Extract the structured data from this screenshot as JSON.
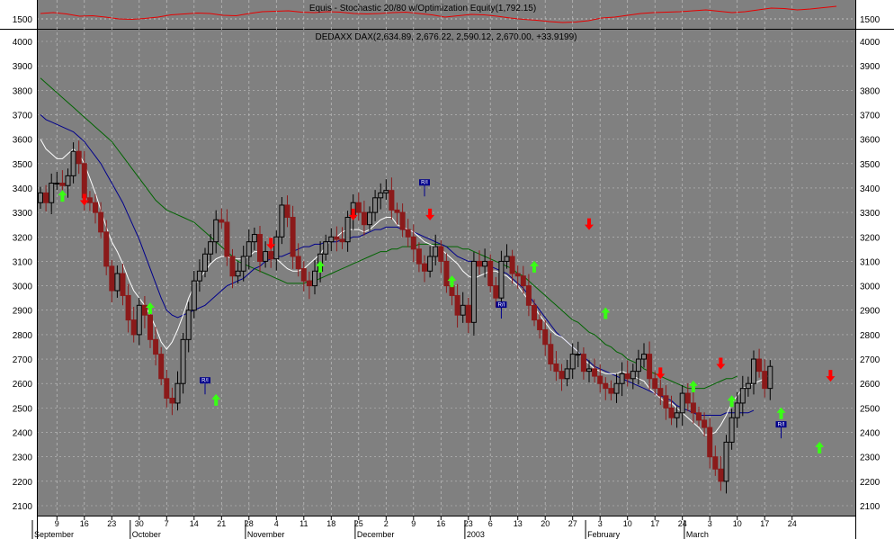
{
  "chart_data": [
    {
      "type": "line",
      "title": "Equis - Stochastic 20/80 w/Optimization Equity(1,792.15)",
      "yticks": [
        1500
      ],
      "colors": {
        "series": "#e60000"
      },
      "series": [
        {
          "values": [
            1560,
            1570,
            1555,
            1530,
            1535,
            1520,
            1500,
            1495,
            1505,
            1520,
            1545,
            1555,
            1565,
            1560,
            1540,
            1535,
            1560,
            1580,
            1585,
            1590,
            1575,
            1570,
            1580,
            1575,
            1560,
            1555,
            1560,
            1570,
            1575,
            1560,
            1545,
            1520,
            1535,
            1550,
            1545,
            1530,
            1510,
            1495,
            1485,
            1470,
            1460,
            1465,
            1480,
            1510,
            1520,
            1540,
            1560,
            1570,
            1575,
            1580,
            1590,
            1600,
            1585,
            1570,
            1580,
            1600,
            1620,
            1615,
            1600,
            1610,
            1625,
            1640
          ]
        }
      ]
    },
    {
      "type": "candlestick",
      "title": "DEDAXX DAX(2,634.89, 2,676.22, 2,590.12, 2,670.00, +33.9199)",
      "ylim": [
        2050,
        4050
      ],
      "yticks": [
        2100,
        2200,
        2300,
        2400,
        2500,
        2600,
        2700,
        2800,
        2900,
        3000,
        3100,
        3200,
        3300,
        3400,
        3500,
        3600,
        3700,
        3800,
        3900,
        4000
      ],
      "xticks": [
        {
          "label": "9",
          "i": 3
        },
        {
          "label": "16",
          "i": 8
        },
        {
          "label": "23",
          "i": 13
        },
        {
          "label": "30",
          "i": 18
        },
        {
          "label": "7",
          "i": 23
        },
        {
          "label": "14",
          "i": 28
        },
        {
          "label": "21",
          "i": 33
        },
        {
          "label": "28",
          "i": 38
        },
        {
          "label": "4",
          "i": 43
        },
        {
          "label": "11",
          "i": 48
        },
        {
          "label": "18",
          "i": 53
        },
        {
          "label": "25",
          "i": 58
        },
        {
          "label": "2",
          "i": 63
        },
        {
          "label": "9",
          "i": 68
        },
        {
          "label": "16",
          "i": 73
        },
        {
          "label": "23",
          "i": 78
        },
        {
          "label": "6",
          "i": 82
        },
        {
          "label": "13",
          "i": 87
        },
        {
          "label": "20",
          "i": 92
        },
        {
          "label": "27",
          "i": 97
        },
        {
          "label": "3",
          "i": 102
        },
        {
          "label": "10",
          "i": 107
        },
        {
          "label": "17",
          "i": 112
        },
        {
          "label": "24",
          "i": 117
        },
        {
          "label": "3",
          "i": 122
        },
        {
          "label": "10",
          "i": 127
        },
        {
          "label": "17",
          "i": 132
        },
        {
          "label": "24",
          "i": 137
        }
      ],
      "months": [
        {
          "label": "September",
          "i": 0
        },
        {
          "label": "October",
          "i": 18
        },
        {
          "label": "November",
          "i": 39
        },
        {
          "label": "December",
          "i": 59
        },
        {
          "label": "2003",
          "i": 79
        },
        {
          "label": "February",
          "i": 101
        },
        {
          "label": "March",
          "i": 119
        }
      ],
      "colors": {
        "bear": "#8b1a1a",
        "bull": "#000000",
        "ema": "#ffffff",
        "ma_mid": "#00008b",
        "ma_long": "#006400",
        "buy": "#39ff14",
        "sell": "#ff0000",
        "flag": "#00008b",
        "background": "#808080",
        "grid": "#c0c0c0"
      },
      "close": [
        3380,
        3340,
        3420,
        3420,
        3410,
        3450,
        3550,
        3500,
        3360,
        3340,
        3300,
        3220,
        3080,
        2980,
        3050,
        2960,
        2860,
        2800,
        2920,
        2880,
        2780,
        2720,
        2620,
        2540,
        2520,
        2600,
        2780,
        2900,
        3020,
        3060,
        3130,
        3180,
        3270,
        3260,
        3120,
        3040,
        3060,
        3120,
        3180,
        3210,
        3100,
        3140,
        3110,
        3200,
        3330,
        3280,
        3120,
        3070,
        3020,
        3000,
        3060,
        3130,
        3180,
        3200,
        3190,
        3180,
        3280,
        3340,
        3300,
        3250,
        3300,
        3360,
        3380,
        3390,
        3310,
        3300,
        3230,
        3200,
        3150,
        3090,
        3060,
        3120,
        3160,
        3100,
        3000,
        2960,
        2880,
        2920,
        2850,
        3100,
        3080,
        3100,
        3000,
        2950,
        3100,
        3120,
        3050,
        3040,
        3000,
        2920,
        2860,
        2820,
        2760,
        2680,
        2650,
        2620,
        2660,
        2720,
        2720,
        2650,
        2660,
        2630,
        2600,
        2580,
        2560,
        2600,
        2640,
        2620,
        2650,
        2700,
        2720,
        2620,
        2580,
        2550,
        2500,
        2460,
        2480,
        2560,
        2520,
        2480,
        2450,
        2420,
        2300,
        2250,
        2200,
        2360,
        2460,
        2520,
        2580,
        2600,
        2700,
        2650,
        2580,
        2670
      ],
      "ema": [
        3600,
        3560,
        3540,
        3520,
        3520,
        3540,
        3560,
        3540,
        3500,
        3440,
        3380,
        3310,
        3240,
        3180,
        3140,
        3090,
        3030,
        2980,
        2950,
        2920,
        2880,
        2830,
        2770,
        2740,
        2770,
        2820,
        2880,
        2950,
        3000,
        3030,
        3060,
        3090,
        3110,
        3120,
        3120,
        3110,
        3110,
        3110,
        3120,
        3140,
        3140,
        3140,
        3130,
        3110,
        3090,
        3070,
        3060,
        3060,
        3070,
        3090,
        3110,
        3130,
        3160,
        3190,
        3200,
        3220,
        3230,
        3230,
        3230,
        3220,
        3230,
        3250,
        3270,
        3280,
        3280,
        3250,
        3240,
        3230,
        3220,
        3200,
        3180,
        3170,
        3160,
        3150,
        3130,
        3110,
        3090,
        3060,
        3040,
        3030,
        3040,
        3050,
        3060,
        3060,
        3050,
        3040,
        3020,
        3000,
        2970,
        2940,
        2910,
        2880,
        2850,
        2820,
        2800,
        2790,
        2770,
        2750,
        2730,
        2700,
        2680,
        2660,
        2650,
        2640,
        2640,
        2640,
        2650,
        2640,
        2630,
        2620,
        2610,
        2580,
        2560,
        2540,
        2520,
        2520,
        2500,
        2480,
        2460,
        2440,
        2420,
        2390,
        2390,
        2400,
        2430,
        2470,
        2520,
        2550,
        2580,
        2590,
        2600,
        2610,
        2620,
        2640
      ],
      "ma_mid": [
        3700,
        3680,
        3670,
        3660,
        3650,
        3640,
        3630,
        3610,
        3590,
        3560,
        3530,
        3500,
        3460,
        3420,
        3380,
        3340,
        3290,
        3240,
        3190,
        3130,
        3070,
        3010,
        2950,
        2900,
        2880,
        2870,
        2880,
        2890,
        2900,
        2910,
        2920,
        2940,
        2960,
        2980,
        3000,
        3010,
        3020,
        3030,
        3050,
        3070,
        3080,
        3100,
        3110,
        3120,
        3120,
        3130,
        3140,
        3150,
        3160,
        3160,
        3170,
        3170,
        3180,
        3180,
        3180,
        3190,
        3190,
        3200,
        3200,
        3210,
        3220,
        3230,
        3230,
        3240,
        3240,
        3240,
        3230,
        3230,
        3220,
        3210,
        3200,
        3190,
        3180,
        3170,
        3160,
        3140,
        3120,
        3110,
        3100,
        3100,
        3090,
        3090,
        3080,
        3070,
        3060,
        3050,
        3030,
        3010,
        2990,
        2960,
        2930,
        2900,
        2870,
        2840,
        2810,
        2790,
        2770,
        2750,
        2730,
        2710,
        2690,
        2670,
        2660,
        2650,
        2640,
        2630,
        2620,
        2610,
        2600,
        2590,
        2580,
        2570,
        2560,
        2550,
        2540,
        2530,
        2510,
        2500,
        2490,
        2480,
        2470,
        2470,
        2470,
        2470,
        2470,
        2480,
        2480,
        2480,
        2480,
        2480,
        2490
      ],
      "ma_long": [
        3850,
        3830,
        3810,
        3790,
        3770,
        3750,
        3730,
        3710,
        3690,
        3670,
        3650,
        3630,
        3610,
        3590,
        3560,
        3530,
        3500,
        3470,
        3440,
        3410,
        3380,
        3350,
        3330,
        3310,
        3300,
        3290,
        3280,
        3270,
        3260,
        3240,
        3220,
        3200,
        3180,
        3160,
        3140,
        3120,
        3100,
        3090,
        3080,
        3070,
        3060,
        3050,
        3040,
        3030,
        3020,
        3010,
        3010,
        3010,
        3010,
        3020,
        3020,
        3030,
        3040,
        3050,
        3060,
        3070,
        3080,
        3090,
        3100,
        3110,
        3120,
        3130,
        3140,
        3140,
        3150,
        3150,
        3160,
        3160,
        3160,
        3170,
        3170,
        3170,
        3170,
        3170,
        3160,
        3160,
        3160,
        3150,
        3150,
        3140,
        3130,
        3120,
        3110,
        3100,
        3090,
        3080,
        3070,
        3050,
        3040,
        3020,
        3000,
        2980,
        2960,
        2940,
        2920,
        2900,
        2880,
        2860,
        2850,
        2830,
        2810,
        2800,
        2780,
        2760,
        2750,
        2730,
        2720,
        2700,
        2690,
        2680,
        2660,
        2650,
        2640,
        2630,
        2620,
        2610,
        2600,
        2590,
        2580,
        2580,
        2580,
        2580,
        2590,
        2600,
        2610,
        2620,
        2620,
        2630
      ],
      "buy_signals": [
        {
          "i": 4,
          "v": 3370
        },
        {
          "i": 20,
          "v": 2910
        },
        {
          "i": 32,
          "v": 2535
        },
        {
          "i": 51,
          "v": 3080
        },
        {
          "i": 75,
          "v": 3020
        },
        {
          "i": 90,
          "v": 3080
        },
        {
          "i": 103,
          "v": 2890
        },
        {
          "i": 119,
          "v": 2590
        },
        {
          "i": 126,
          "v": 2530
        },
        {
          "i": 135,
          "v": 2480
        },
        {
          "i": 142,
          "v": 2340
        }
      ],
      "sell_signals": [
        {
          "i": 8,
          "v": 3350
        },
        {
          "i": 42,
          "v": 3170
        },
        {
          "i": 57,
          "v": 3290
        },
        {
          "i": 71,
          "v": 3290
        },
        {
          "i": 100,
          "v": 3250
        },
        {
          "i": 113,
          "v": 2640
        },
        {
          "i": 124,
          "v": 2680
        },
        {
          "i": 144,
          "v": 2630
        }
      ],
      "flag_label": "R/I",
      "flags": [
        {
          "i": 30,
          "v": 2600
        },
        {
          "i": 70,
          "v": 3410
        },
        {
          "i": 84,
          "v": 2910
        },
        {
          "i": 135,
          "v": 2420
        }
      ]
    }
  ]
}
